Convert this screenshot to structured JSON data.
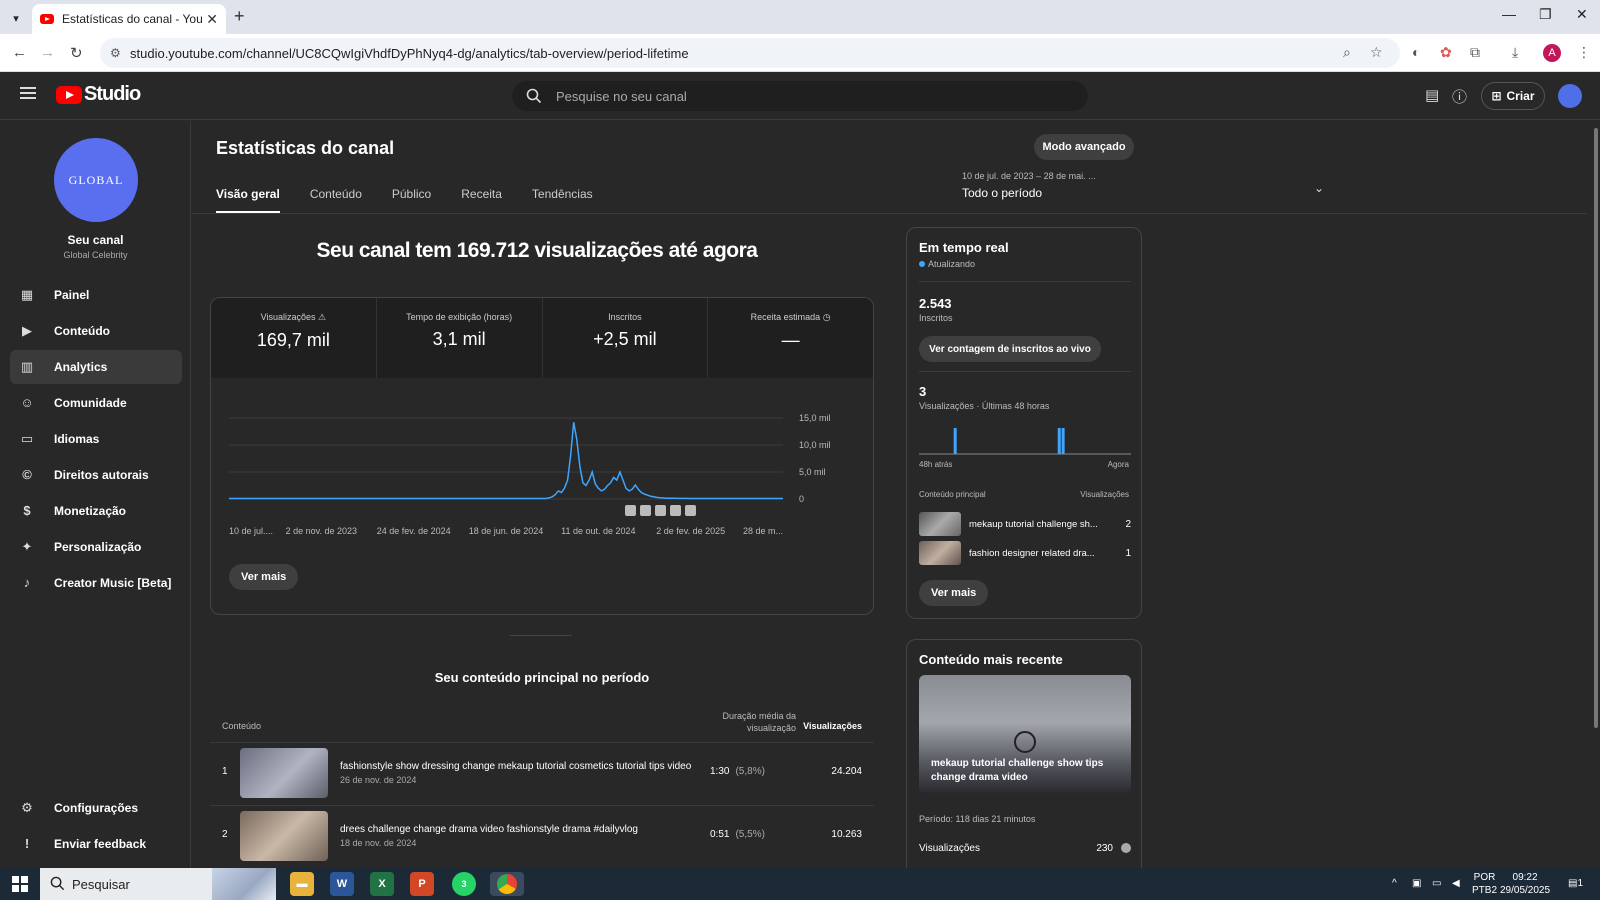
{
  "browser": {
    "tab_title": "Estatísticas do canal - YouTube",
    "url": "studio.youtube.com/channel/UC8CQwIgiVhdfDyPhNyq4-dg/analytics/tab-overview/period-lifetime",
    "profile_initial": "A"
  },
  "header": {
    "logo_text": "Studio",
    "search_placeholder": "Pesquise no seu canal",
    "create_label": "Criar"
  },
  "sidebar": {
    "channel_avatar_text": "GLOBAL",
    "channel_title": "Seu canal",
    "channel_name": "Global Celebrity",
    "items": [
      {
        "label": "Painel",
        "icon": "dashboard-icon"
      },
      {
        "label": "Conteúdo",
        "icon": "content-icon"
      },
      {
        "label": "Analytics",
        "icon": "analytics-icon",
        "active": true
      },
      {
        "label": "Comunidade",
        "icon": "community-icon"
      },
      {
        "label": "Idiomas",
        "icon": "subtitles-icon"
      },
      {
        "label": "Direitos autorais",
        "icon": "copyright-icon"
      },
      {
        "label": "Monetização",
        "icon": "dollar-icon"
      },
      {
        "label": "Personalização",
        "icon": "magic-wand-icon"
      },
      {
        "label": "Creator Music [Beta]",
        "icon": "music-icon"
      }
    ],
    "bottom": [
      {
        "label": "Configurações",
        "icon": "gear-icon"
      },
      {
        "label": "Enviar feedback",
        "icon": "feedback-icon"
      }
    ]
  },
  "main": {
    "title": "Estatísticas do canal",
    "advanced_button": "Modo avançado",
    "tabs": [
      "Visão geral",
      "Conteúdo",
      "Público",
      "Receita",
      "Tendências"
    ],
    "period_range": "10 de jul. de 2023 – 28 de mai. ...",
    "period_label": "Todo o período",
    "headline": "Seu canal tem 169.712 visualizações até agora",
    "metrics": [
      {
        "label": "Visualizações",
        "value": "169,7 mil"
      },
      {
        "label": "Tempo de exibição (horas)",
        "value": "3,1 mil"
      },
      {
        "label": "Inscritos",
        "value": "+2,5 mil"
      },
      {
        "label": "Receita estimada",
        "value": "—"
      }
    ],
    "see_more": "Ver mais",
    "top_content_title": "Seu conteúdo principal no período",
    "table_headers": {
      "content": "Conteúdo",
      "avg_duration": "Duração média da visualização",
      "views": "Visualizações"
    },
    "rows": [
      {
        "rank": "1",
        "title": "fashionstyle show dressing change mekaup tutorial cosmetics tutorial tips video",
        "date": "26 de nov. de 2024",
        "duration": "1:30",
        "pct": "(5,8%)",
        "views": "24.204"
      },
      {
        "rank": "2",
        "title": "drees challenge change drama video fashionstyle drama #dailyvlog",
        "date": "18 de nov. de 2024",
        "duration": "0:51",
        "pct": "(5,5%)",
        "views": "10.263"
      }
    ]
  },
  "realtime": {
    "title": "Em tempo real",
    "status": "Atualizando",
    "subscribers": "2.543",
    "subscribers_label": "Inscritos",
    "live_button": "Ver contagem de inscritos ao vivo",
    "views": "3",
    "views_label": "Visualizações · Últimas 48 horas",
    "axis_left": "48h atrás",
    "axis_right": "Agora",
    "col_content": "Conteúdo principal",
    "col_views": "Visualizações",
    "items": [
      {
        "title": "mekaup tutorial challenge sh...",
        "views": "2"
      },
      {
        "title": "fashion designer related dra...",
        "views": "1"
      }
    ],
    "see_more": "Ver mais",
    "bars": [
      0,
      0,
      0,
      0,
      0,
      0,
      0,
      0,
      0,
      0,
      0,
      0,
      0,
      0,
      0,
      0,
      0,
      0,
      0,
      0,
      0,
      0,
      0,
      0,
      0,
      0,
      0,
      0,
      0,
      0,
      0,
      0,
      0,
      0,
      0,
      0,
      0,
      0,
      0,
      0,
      0,
      0,
      0,
      0,
      0,
      0,
      0,
      0,
      0,
      0,
      0,
      0,
      0,
      0,
      0,
      0,
      0,
      0,
      0,
      0,
      0,
      0,
      0,
      0,
      0,
      0,
      0,
      0,
      0,
      0,
      0,
      0,
      0,
      0,
      0,
      0,
      0,
      0,
      0,
      0,
      0,
      0,
      0,
      0,
      0,
      0,
      0,
      0,
      0,
      0,
      0,
      0,
      0,
      0,
      0,
      0,
      0,
      0,
      0,
      0,
      0,
      0,
      0,
      0,
      0,
      0,
      0,
      0,
      0,
      0,
      0,
      0,
      0,
      0,
      0,
      0,
      0,
      0,
      0,
      0,
      0,
      0,
      0,
      0,
      0,
      0,
      0,
      0
    ]
  },
  "recent": {
    "title": "Conteúdo mais recente",
    "video_caption": "mekaup tutorial challenge show tips change drama video",
    "period": "Período: 118 dias 21 minutos",
    "metric_label": "Visualizações",
    "metric_value": "230"
  },
  "taskbar": {
    "search": "Pesquisar",
    "lang1": "POR",
    "lang2": "PTB2",
    "time": "09:22",
    "date": "29/05/2025",
    "whatsapp_badge": "3",
    "notif_count": "1"
  },
  "chart_data": {
    "type": "line",
    "title": "",
    "xlabel": "",
    "ylabel": "",
    "x_tick_labels": [
      "10 de jul....",
      "2 de nov. de 2023",
      "24 de fev. de 2024",
      "18 de jun. de 2024",
      "11 de out. de 2024",
      "2 de fev. de 2025",
      "28 de m..."
    ],
    "y_tick_labels": [
      "15,0 mil",
      "10,0 mil",
      "5,0 mil",
      "0"
    ],
    "ylim": [
      0,
      15000
    ],
    "series": [
      {
        "color": "#3ea6ff",
        "values": [
          100,
          100,
          100,
          100,
          100,
          100,
          100,
          100,
          100,
          100,
          100,
          100,
          100,
          100,
          100,
          100,
          100,
          100,
          100,
          100,
          100,
          100,
          100,
          100,
          100,
          100,
          100,
          100,
          100,
          100,
          100,
          100,
          100,
          100,
          100,
          100,
          100,
          100,
          100,
          100,
          100,
          100,
          100,
          100,
          100,
          100,
          100,
          100,
          100,
          100,
          100,
          100,
          100,
          100,
          100,
          100,
          100,
          100,
          100,
          100,
          100,
          100,
          100,
          100,
          100,
          100,
          100,
          100,
          100,
          100,
          100,
          100,
          100,
          100,
          100,
          100,
          100,
          100,
          100,
          100,
          100,
          100,
          100,
          100,
          100,
          100,
          100,
          100,
          100,
          100,
          100,
          100,
          100,
          100,
          100,
          100,
          100,
          100,
          100,
          100,
          100,
          100,
          100,
          100,
          200,
          400,
          800,
          1500,
          1200,
          2000,
          3500,
          8000,
          14200,
          11000,
          6000,
          3000,
          2500,
          3500,
          5000,
          2800,
          2000,
          1500,
          1800,
          2500,
          3000,
          4000,
          3500,
          5000,
          3500,
          2000,
          1500,
          1800,
          2600,
          1800,
          1200,
          900,
          700,
          500,
          400,
          300,
          250,
          200,
          150,
          150,
          150,
          150,
          120,
          120,
          120,
          120,
          100,
          100,
          100,
          100,
          100,
          100,
          100,
          100,
          100,
          100,
          100,
          100,
          100,
          100,
          100,
          100,
          100,
          100,
          100,
          100,
          100,
          100,
          100,
          100,
          100,
          100,
          100,
          100,
          100,
          100,
          100
        ]
      }
    ]
  }
}
